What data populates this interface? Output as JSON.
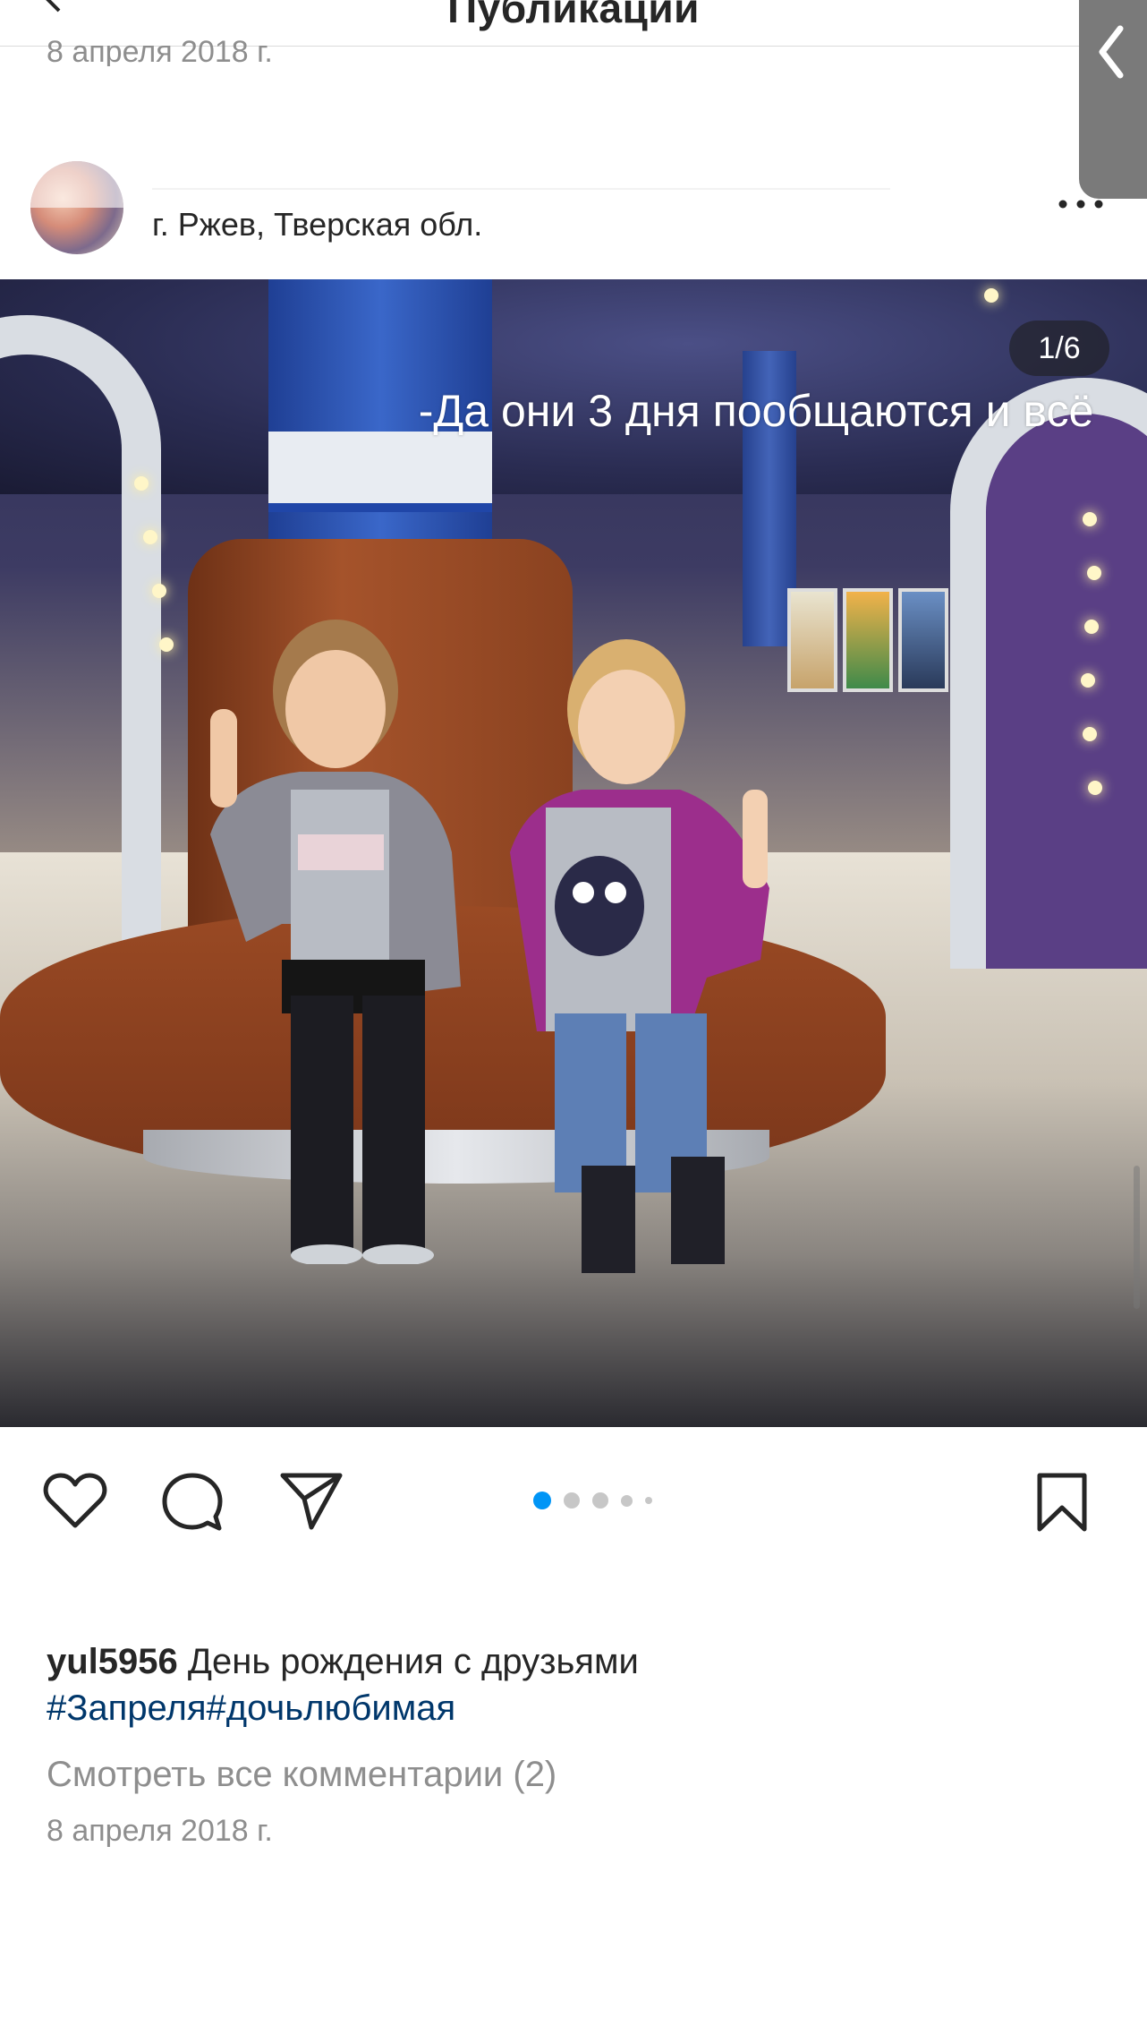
{
  "header": {
    "title": "Публикации",
    "previous_post_date": "8 апреля 2018 г."
  },
  "post": {
    "location": "г. Ржев, Тверская обл.",
    "image_counter": "1/6",
    "overlay_caption": "-Да они 3 дня пообщаются и всё",
    "carousel_dots": 5,
    "active_dot": 0,
    "caption_username": "yul5956",
    "caption_text": "День рождения с друзьями",
    "hashtags": "#Запреля#дочьлюбимая",
    "view_comments": "Смотреть все комментарии (2)",
    "date": "8 апреля 2018 г."
  },
  "icons": {
    "back": "chevron-left-icon",
    "more": "more-horizontal-icon",
    "like": "heart-icon",
    "comment": "comment-bubble-icon",
    "share": "paper-plane-icon",
    "save": "bookmark-icon",
    "edge_handle": "chevron-left-icon"
  },
  "colors": {
    "accent_blue": "#0095f6",
    "hashtag": "#00376b",
    "muted": "#8e8e8e",
    "text": "#262626"
  }
}
